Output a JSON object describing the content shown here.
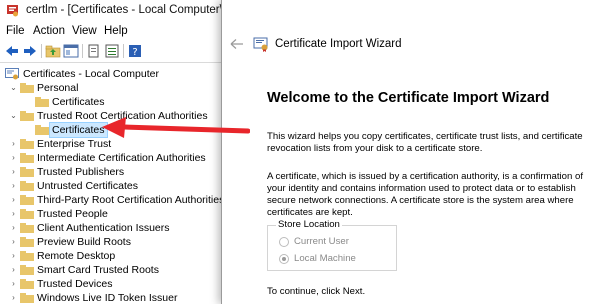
{
  "window": {
    "title": "certlm - [Certificates - Local Computer\\Trusted Root Certification Authorities\\Certificates]",
    "icon": "certificate-manager-icon"
  },
  "menu": [
    "File",
    "Action",
    "View",
    "Help"
  ],
  "toolbar": {
    "icons": [
      "back-arrow-icon",
      "forward-arrow-icon",
      "up-folder-icon",
      "show-hide-tree-icon",
      "copy-icon",
      "export-list-icon",
      "help-icon"
    ]
  },
  "tree": {
    "root": "Certificates - Local Computer",
    "items": [
      {
        "label": "Personal",
        "expanded": true
      },
      {
        "label": "Certificates",
        "child": true
      },
      {
        "label": "Trusted Root Certification Authorities",
        "expanded": true
      },
      {
        "label": "Certificates",
        "child": true,
        "selected": true
      },
      {
        "label": "Enterprise Trust"
      },
      {
        "label": "Intermediate Certification Authorities"
      },
      {
        "label": "Trusted Publishers"
      },
      {
        "label": "Untrusted Certificates"
      },
      {
        "label": "Third-Party Root Certification Authorities"
      },
      {
        "label": "Trusted People"
      },
      {
        "label": "Client Authentication Issuers"
      },
      {
        "label": "Preview Build Roots"
      },
      {
        "label": "Remote Desktop"
      },
      {
        "label": "Smart Card Trusted Roots"
      },
      {
        "label": "Trusted Devices"
      },
      {
        "label": "Windows Live ID Token Issuer"
      }
    ]
  },
  "wizard": {
    "title": "Certificate Import Wizard",
    "heading": "Welcome to the Certificate Import Wizard",
    "para1": "This wizard helps you copy certificates, certificate trust lists, and certificate revocation lists from your disk to a certificate store.",
    "para2": "A certificate, which is issued by a certification authority, is a confirmation of your identity and contains information used to protect data or to establish secure network connections. A certificate store is the system area where certificates are kept.",
    "store_location": {
      "legend": "Store Location",
      "options": [
        {
          "label": "Current User",
          "selected": false
        },
        {
          "label": "Local Machine",
          "selected": true
        }
      ]
    },
    "footer": "To continue, click Next."
  },
  "colors": {
    "folder": "#e8c66a",
    "selection": "#cce8ff",
    "annotation_arrow": "#e8262b",
    "back_arrow": "#1f5fbf"
  }
}
